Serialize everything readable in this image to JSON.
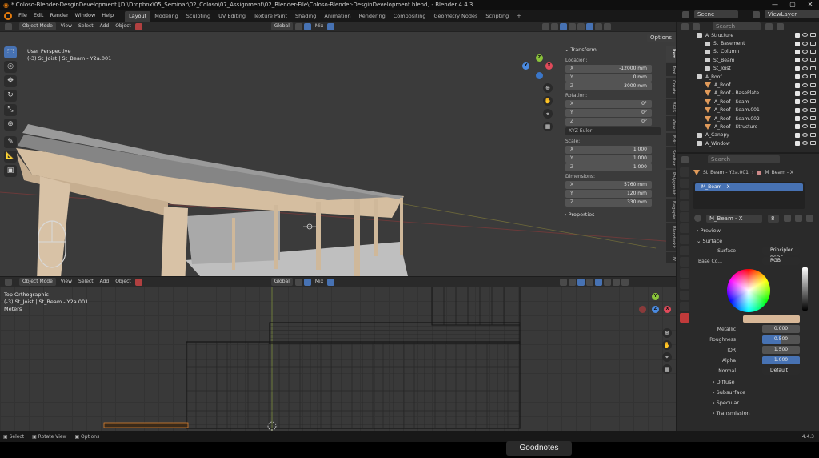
{
  "window": {
    "title": "* Coloso-Blender-DesginDevelopment [D:\\Dropbox\\05_Seminar\\02_Coloso\\07_Assignment\\02_Blender-File\\Coloso-Blender-DesginDevelopment.blend] - Blender 4.4.3",
    "controls": [
      "—",
      "▢",
      "✕"
    ]
  },
  "menu": {
    "items": [
      "File",
      "Edit",
      "Render",
      "Window",
      "Help"
    ],
    "workspaces": [
      "Layout",
      "Modeling",
      "Sculpting",
      "UV Editing",
      "Texture Paint",
      "Shading",
      "Animation",
      "Rendering",
      "Compositing",
      "Geometry Nodes",
      "Scripting"
    ],
    "add_workspace": "+",
    "scene_label": "Scene",
    "viewlayer_label": "ViewLayer"
  },
  "viewport_top": {
    "mode": "Object Mode",
    "menus": [
      "View",
      "Select",
      "Add",
      "Object"
    ],
    "orientation": "Global",
    "shading_mix": "Mix",
    "options_label": "Options",
    "view_name": "User Perspective",
    "object_info": "(-3) St_Joist | St_Beam - Y2a.001",
    "npanel": {
      "transform_header": "Transform",
      "location_label": "Location:",
      "location": [
        {
          "axis": "X",
          "value": "-12000 mm"
        },
        {
          "axis": "Y",
          "value": "0 mm"
        },
        {
          "axis": "Z",
          "value": "3000 mm"
        }
      ],
      "rotation_label": "Rotation:",
      "rotation": [
        {
          "axis": "X",
          "value": "0°"
        },
        {
          "axis": "Y",
          "value": "0°"
        },
        {
          "axis": "Z",
          "value": "0°"
        }
      ],
      "rotation_mode": "XYZ Euler",
      "scale_label": "Scale:",
      "scale": [
        {
          "axis": "X",
          "value": "1.000"
        },
        {
          "axis": "Y",
          "value": "1.000"
        },
        {
          "axis": "Z",
          "value": "1.000"
        }
      ],
      "dimensions_label": "Dimensions:",
      "dimensions": [
        {
          "axis": "X",
          "value": "5760 mm"
        },
        {
          "axis": "Y",
          "value": "120 mm"
        },
        {
          "axis": "Z",
          "value": "330 mm"
        }
      ],
      "properties_header": "Properties"
    },
    "side_tabs": [
      "Item",
      "Tool",
      "Create",
      "BGIS",
      "View",
      "Edit",
      "Scatter",
      "Polygonist",
      "Bagapie",
      "Blenderkit",
      "UV"
    ]
  },
  "viewport_bottom": {
    "mode": "Object Mode",
    "menus": [
      "View",
      "Select",
      "Add",
      "Object"
    ],
    "orientation": "Global",
    "shading_mix": "Mix",
    "view_name": "Top Orthographic",
    "object_info": "(-3) St_Joist | St_Beam - Y2a.001",
    "units": "Meters"
  },
  "gizmo": {
    "x": "X",
    "y": "Y",
    "z": "Z"
  },
  "outliner": {
    "search_placeholder": "Search",
    "rows": [
      {
        "name": "A_Structure",
        "kind": "collection",
        "indent": 1
      },
      {
        "name": "St_Basement",
        "kind": "collection",
        "indent": 2
      },
      {
        "name": "St_Column",
        "kind": "collection",
        "indent": 2
      },
      {
        "name": "St_Beam",
        "kind": "collection",
        "indent": 2
      },
      {
        "name": "St_Joist",
        "kind": "collection",
        "indent": 2
      },
      {
        "name": "A_Roof",
        "kind": "collection",
        "indent": 1
      },
      {
        "name": "A_Roof",
        "kind": "object",
        "indent": 2
      },
      {
        "name": "A_Roof - BasePlate",
        "kind": "object",
        "indent": 2
      },
      {
        "name": "A_Roof - Seam",
        "kind": "object",
        "indent": 2
      },
      {
        "name": "A_Roof - Seam.001",
        "kind": "object",
        "indent": 2
      },
      {
        "name": "A_Roof - Seam.002",
        "kind": "object",
        "indent": 2
      },
      {
        "name": "A_Roof - Structure",
        "kind": "object",
        "indent": 2
      },
      {
        "name": "A_Canopy",
        "kind": "collection",
        "indent": 1
      },
      {
        "name": "A_Window",
        "kind": "collection",
        "indent": 1
      }
    ]
  },
  "properties": {
    "search_placeholder": "Search",
    "object_name": "St_Beam - Y2a.001",
    "material_breadcrumb": "M_Beam - X",
    "slot_name": "M_Beam - X",
    "material_name": "M_Beam - X",
    "user_count": "8",
    "preview_label": "Preview",
    "surface_header": "Surface",
    "surface_label": "Surface",
    "surface_value": "Principled BSDF",
    "base_color_label": "Base Co...",
    "base_color_value": "RGB",
    "base_color_hex": "#d8b898",
    "params": [
      {
        "label": "Metallic",
        "value": "0.000",
        "fill": 0
      },
      {
        "label": "Roughness",
        "value": "0.500",
        "fill": 0.5
      },
      {
        "label": "IOR",
        "value": "1.500",
        "fill": 0
      },
      {
        "label": "Alpha",
        "value": "1.000",
        "fill": 1
      }
    ],
    "normal_label": "Normal",
    "normal_value": "Default",
    "collapsed_sections": [
      "Diffuse",
      "Subsurface",
      "Specular",
      "Transmission"
    ]
  },
  "status": {
    "items": [
      "Select",
      "Rotate View",
      "Options"
    ],
    "version": "4.4.3"
  },
  "overlay": {
    "goodnotes": "Goodnotes"
  }
}
